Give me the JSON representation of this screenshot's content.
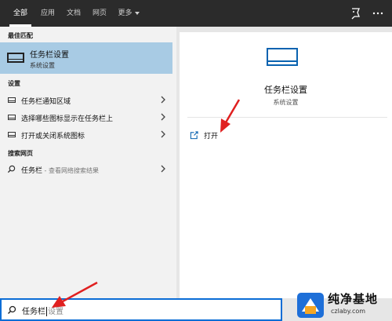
{
  "topbar": {
    "tabs": [
      {
        "label": "全部",
        "active": true
      },
      {
        "label": "应用",
        "active": false
      },
      {
        "label": "文档",
        "active": false
      },
      {
        "label": "网页",
        "active": false
      },
      {
        "label": "更多",
        "active": false,
        "dropdown": true
      }
    ],
    "icons": [
      "feedback-icon",
      "more-options-icon"
    ]
  },
  "left": {
    "best_match_header": "最佳匹配",
    "best_match": {
      "title": "任务栏设置",
      "subtitle": "系统设置",
      "icon": "taskbar-icon"
    },
    "settings_header": "设置",
    "settings_items": [
      {
        "label": "任务栏通知区域",
        "icon": "taskbar-icon"
      },
      {
        "label": "选择哪些图标显示在任务栏上",
        "icon": "taskbar-icon"
      },
      {
        "label": "打开或关闭系统图标",
        "icon": "taskbar-icon"
      }
    ],
    "web_header": "搜索网页",
    "web_item": {
      "label": "任务栏",
      "sub": " - 查看网络搜索结果",
      "icon": "search-icon"
    }
  },
  "right": {
    "title": "任务栏设置",
    "subtitle": "系统设置",
    "open_label": "打开"
  },
  "search": {
    "typed": "任务栏",
    "completion": "设置"
  },
  "watermark": {
    "title": "纯净基地",
    "url": "czlaby.com"
  },
  "colors": {
    "accent": "#0a63b0",
    "selected": "#a8cbe4",
    "arrow": "#e02020"
  }
}
